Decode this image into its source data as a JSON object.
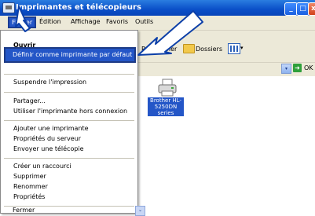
{
  "window": {
    "title": "Imprimantes et télécopieurs",
    "minimize_glyph": "_",
    "maximize_glyph": "□",
    "close_glyph": "x"
  },
  "menubar": {
    "items": [
      "Fichier",
      "Édition",
      "Affichage",
      "Favoris",
      "Outils"
    ]
  },
  "toolbar": {
    "search_label": "Rechercher",
    "folders_label": "Dossiers",
    "views_arrow": "▾"
  },
  "address": {
    "dropdown_glyph": "▾",
    "go_glyph": "➜",
    "go_label": "OK"
  },
  "printer": {
    "label": "Brother HL-5250DN series"
  },
  "dropdown": {
    "partial_top": "Ouvrir",
    "highlighted": "Définir comme imprimante par défaut",
    "groups": [
      [
        "Suspendre l'impression"
      ],
      [
        "Partager...",
        "Utiliser l'imprimante hors connexion"
      ],
      [
        "Ajouter une imprimante",
        "Propriétés du serveur",
        "Envoyer une télécopie"
      ],
      [
        "Créer un raccourci",
        "Supprimer",
        "Renommer",
        "Propriétés"
      ],
      [
        "Fermer"
      ]
    ],
    "scroll_glyph": "⌄"
  },
  "colors": {
    "titlebar": "#0a4fc8",
    "menu_highlight": "#2456c7",
    "arrow_fill": "#ffffff",
    "arrow_stroke": "#0c3fa8"
  }
}
